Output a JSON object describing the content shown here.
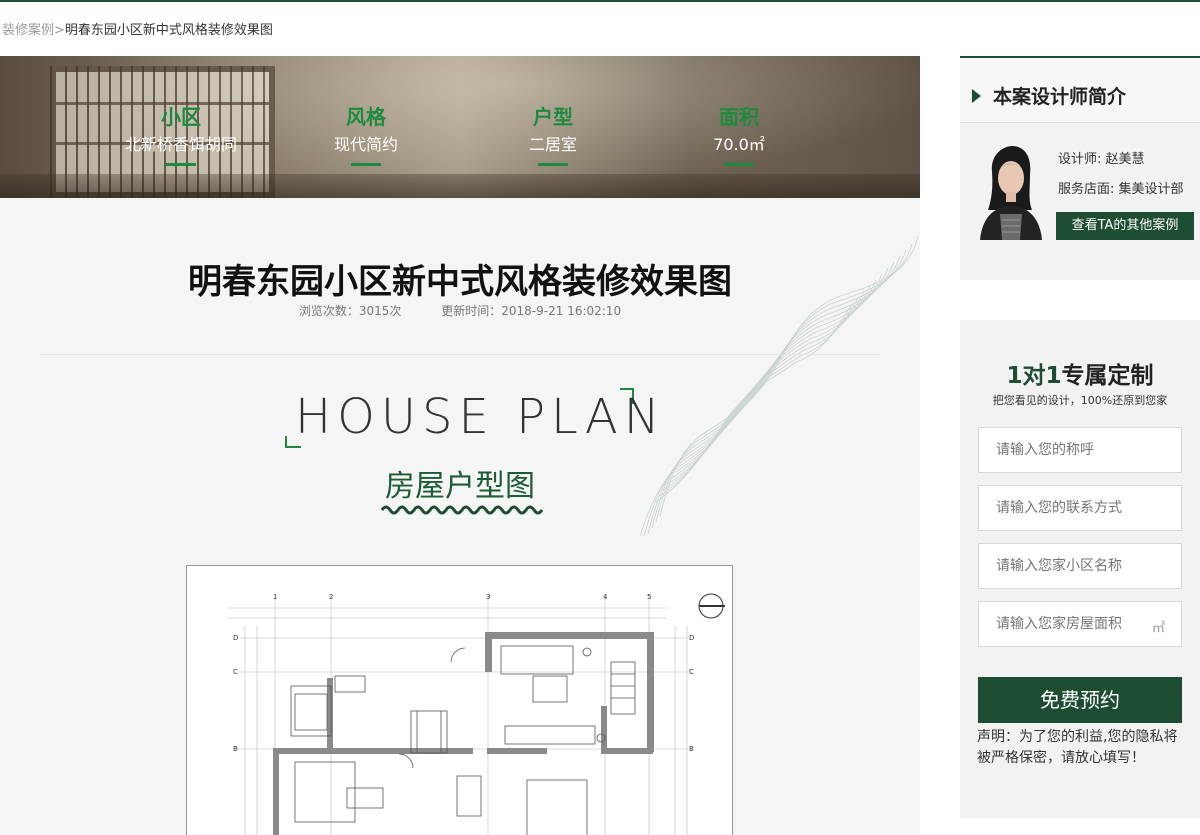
{
  "breadcrumb": {
    "parent": "装修案例",
    "separator": ">",
    "current": "明春东园小区新中式风格装修效果图"
  },
  "banner": {
    "stats": [
      {
        "label": "小区",
        "value": "北新桥香饵胡同"
      },
      {
        "label": "风格",
        "value": "现代简约"
      },
      {
        "label": "户型",
        "value": "二居室"
      },
      {
        "label": "面积",
        "value": "70.0㎡"
      }
    ]
  },
  "article": {
    "title": "明春东园小区新中式风格装修效果图",
    "views": "浏览次数：3015次",
    "updated": "更新时间：2018-9-21  16:02:10"
  },
  "section": {
    "heading_en": "HOUSE  PLAN",
    "heading_cn": "房屋户型图"
  },
  "floorplan": {
    "axis_top": [
      "1",
      "2",
      "3",
      "4",
      "5"
    ],
    "axis_side": [
      "D",
      "C",
      "B"
    ]
  },
  "designer": {
    "heading": "本案设计师简介",
    "name_line": "设计师: 赵美慧",
    "store_line": "服务店面: 集美设计部",
    "more_button": "查看TA的其他案例"
  },
  "form": {
    "title_num": "1对1",
    "title_text": "专属定制",
    "subtitle": "把您看见的设计，100%还原到您家",
    "fields": [
      {
        "placeholder": "请输入您的称呼"
      },
      {
        "placeholder": "请输入您的联系方式"
      },
      {
        "placeholder": "请输入您家小区名称"
      },
      {
        "placeholder": "请输入您家房屋面积"
      }
    ],
    "area_unit": "㎡",
    "submit_label": "免费预约",
    "notice": "声明：为了您的利益,您的隐私将被严格保密，请放心填写！"
  },
  "colors": {
    "brand_green": "#1d4d33",
    "accent_green": "#1e8a3f"
  }
}
